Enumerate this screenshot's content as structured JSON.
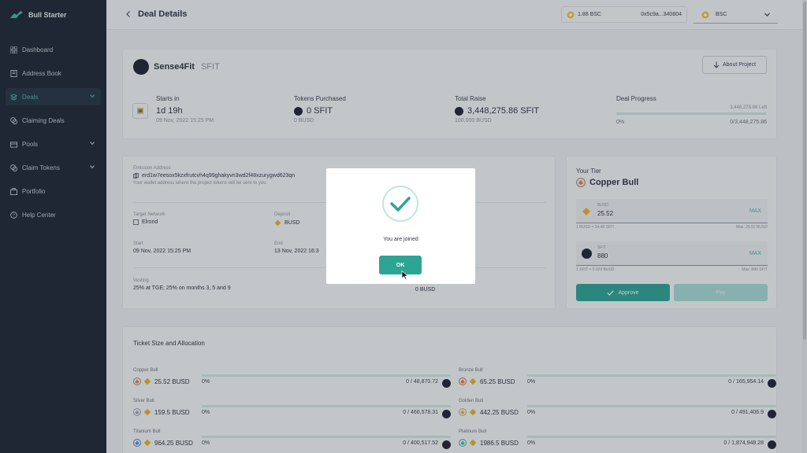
{
  "app": {
    "name": "Bull Starter"
  },
  "sidebar": {
    "items": [
      {
        "label": "Dashboard",
        "icon": "grid-icon"
      },
      {
        "label": "Address Book",
        "icon": "book-icon"
      },
      {
        "label": "Deals",
        "icon": "layers-icon",
        "active": true
      },
      {
        "label": "Claiming Deals",
        "icon": "coins-icon"
      },
      {
        "label": "Pools",
        "icon": "pool-icon"
      },
      {
        "label": "Claim Tokens",
        "icon": "coins-icon"
      },
      {
        "label": "Portfolio",
        "icon": "portfolio-icon"
      },
      {
        "label": "Help Center",
        "icon": "help-icon"
      }
    ]
  },
  "header": {
    "title": "Deal Details",
    "balance": "1.88 BSC",
    "address": "0x5c9a...340804",
    "network": "BSC"
  },
  "project": {
    "name": "Sense4Fit",
    "ticker": "SFIT",
    "about_label": "About Project",
    "starts_label": "Starts in",
    "starts_value": "1d 19h",
    "starts_date": "09 Nov, 2022 15:25 PM",
    "purchased_label": "Tokens Purchased",
    "purchased_value": "0 SFIT",
    "purchased_sub": "0 BUSD",
    "raise_label": "Total Raise",
    "raise_value": "3,448,275.86 SFIT",
    "raise_sub": "100,000 BUSD",
    "progress_label": "Deal Progress",
    "progress_left": "3,448,275.86 Left",
    "progress_pct": "0%",
    "progress_total": "0/3,448,275.86",
    "progress_fraction": 0
  },
  "details": {
    "emission_label": "Emission Address",
    "emission_value": "erd1w7eesox5kzxfrutcvh4q99ghakyvn3wd2f48xzurygwd623qn",
    "emission_help": "Your wallet address where the project tokens will be sent to you",
    "network_label": "Target Network",
    "network_value": "Elrond",
    "deposit_label": "Deposit",
    "deposit_value": "BUSD",
    "start_label": "Start",
    "start_value": "09 Nov, 2022 15:25 PM",
    "end_label": "End",
    "end_value": "13 Nov, 2022 16:3",
    "vesting_label": "Vesting",
    "vesting_value": "25% at TGE; 25% on months 3, 5 and 9",
    "busd_value": "0 BUSD"
  },
  "tier": {
    "title": "Your Tier",
    "name": "Copper Bull",
    "busd_label": "BUSD",
    "busd_value": "25.52",
    "max_label": "MAX",
    "busd_rate": "1 BUSD = 34.48 SFIT",
    "busd_max": "Max: 25.52 BUSD",
    "sfit_label": "SFIT",
    "sfit_value": "880",
    "sfit_rate": "1 SFIT = 0.029 BUSD",
    "sfit_max": "Max: 880 SFIT",
    "approve_label": "Approve",
    "pay_label": "Pay"
  },
  "tickets": {
    "title": "Ticket Size and Allocation",
    "rows": [
      {
        "name": "Copper Bull",
        "amount": "25.52 BUSD",
        "pct": "0%",
        "total": "0 / 48,870.72"
      },
      {
        "name": "Bronze Bull",
        "amount": "65.25 BUSD",
        "pct": "0%",
        "total": "0 / 165,954.14"
      },
      {
        "name": "Silver Bull",
        "amount": "159.5 BUSD",
        "pct": "0%",
        "total": "0 / 466,578.31"
      },
      {
        "name": "Golden Bull",
        "amount": "442.25 BUSD",
        "pct": "0%",
        "total": "0 / 491,406.9"
      },
      {
        "name": "Titanium Bull",
        "amount": "964.25 BUSD",
        "pct": "0%",
        "total": "0 / 400,517.52"
      },
      {
        "name": "Platinum Bull",
        "amount": "1986.5 BUSD",
        "pct": "0%",
        "total": "0 / 1,874,948.28"
      }
    ]
  },
  "modal": {
    "message": "You are joined",
    "ok_label": "OK"
  },
  "colors": {
    "accent": "#2ca594",
    "sidebar_bg": "#1b2430",
    "busd": "#e8b528"
  }
}
